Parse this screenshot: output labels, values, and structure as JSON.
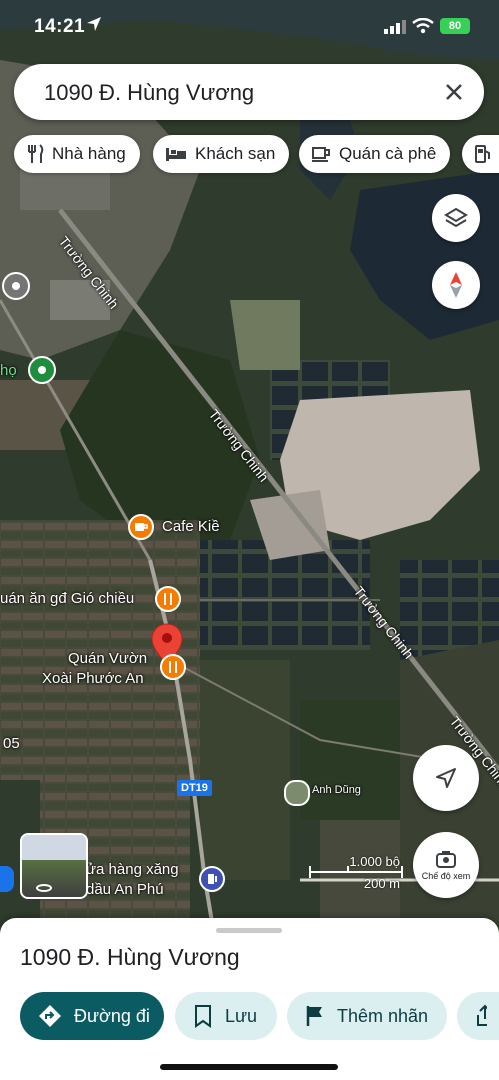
{
  "status_bar": {
    "time": "14:21",
    "battery": "80"
  },
  "search": {
    "query": "1090 Đ. Hùng Vương"
  },
  "chips": [
    {
      "label": "Nhà hàng",
      "icon": "fork-knife-icon"
    },
    {
      "label": "Khách sạn",
      "icon": "bed-icon"
    },
    {
      "label": "Quán cà phê",
      "icon": "coffee-cup-icon"
    },
    {
      "label": "",
      "icon": "gas-pump-icon"
    }
  ],
  "map": {
    "road_labels": [
      "Trường Chinh",
      "Trường Chinh",
      "Trường Chinh",
      "Trường Chinh",
      "Trường Chinh",
      "Trường Chinh"
    ],
    "route_shield": "DT19",
    "place_labels": {
      "cafe": "Cafe Kiề",
      "quan_an": "uán ăn gđ Gió chiều",
      "quan_vuon_line1": "Quán Vườn",
      "quan_vuon_line2": "Xoài Phước An",
      "cua_hang_line1": "ửa hàng xăng",
      "cua_hang_line2": "dầu An Phú",
      "anh_dung": "Anh Dũng",
      "left_edge_ho": "họ",
      "left_edge_num": "05"
    },
    "scale": {
      "feet": "1.000 bộ",
      "meters": "200 m"
    },
    "street_view_label": "Chế độ xem",
    "colors": {
      "pin": "#ea4335",
      "food": "#f57c00",
      "gas": "#3f51b5",
      "park": "#1e8e3e",
      "primary": "#0b5b63",
      "chip_bg": "#dbeef0"
    }
  },
  "sheet": {
    "title": "1090 Đ. Hùng Vương",
    "actions": {
      "directions": "Đường đi",
      "save": "Lưu",
      "label": "Thêm nhãn"
    }
  }
}
